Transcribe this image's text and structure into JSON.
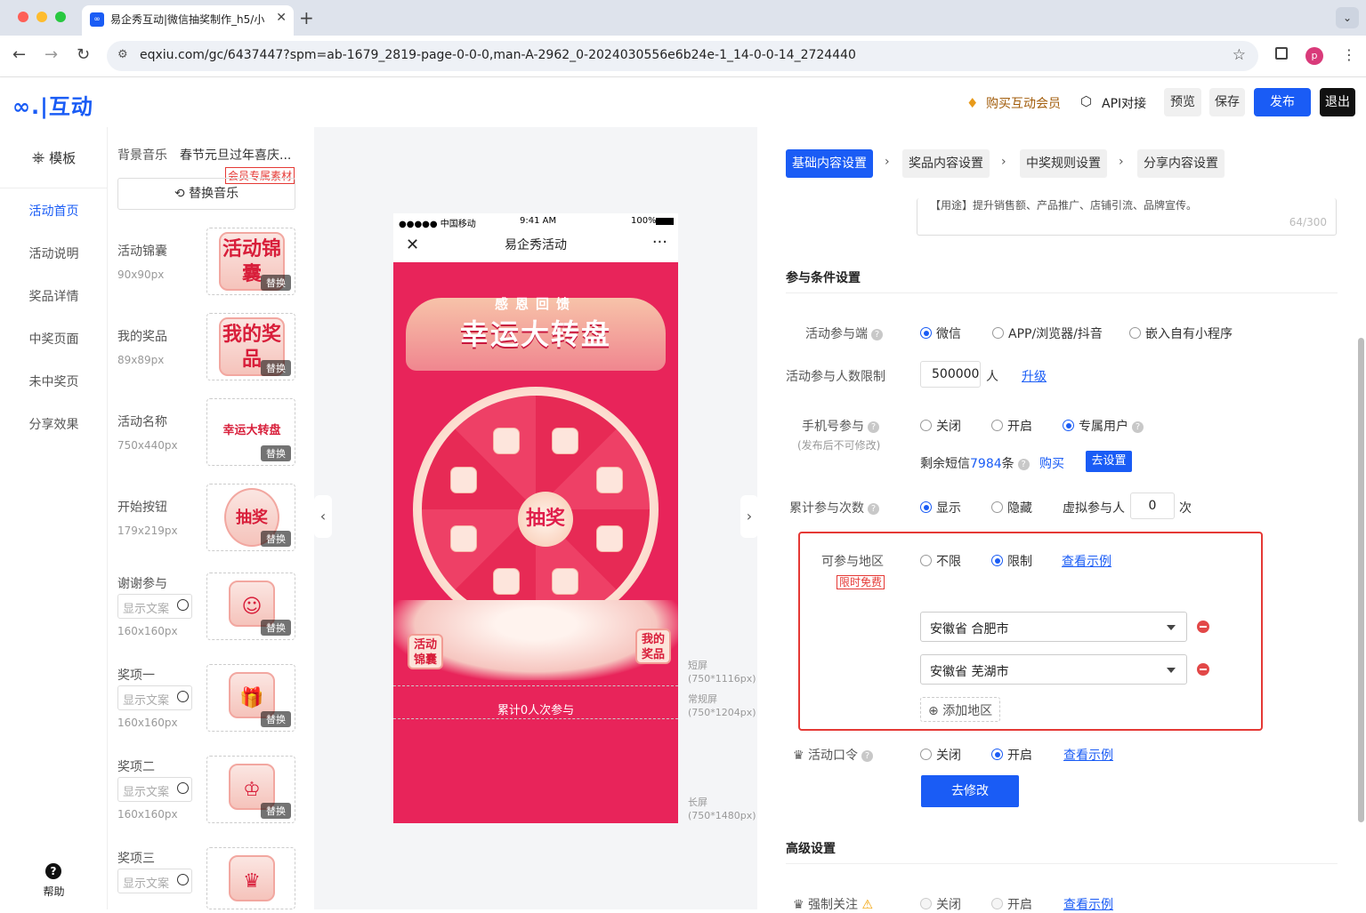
{
  "browser": {
    "tab_title": "易企秀互动|微信抽奖制作_h5/小",
    "url": "eqxiu.com/gc/6437447?spm=ab-1679_2819-page-0-0-0,man-A-2962_0-2024030556e6b24e-1_14-0-0-14_2724440",
    "avatar": "p"
  },
  "header": {
    "logo": "互动",
    "vip": "购买互动会员",
    "api": "API对接",
    "preview": "预览",
    "save": "保存",
    "publish": "发布",
    "exit": "退出"
  },
  "leftnav": {
    "template": "模板",
    "items": [
      "活动首页",
      "活动说明",
      "奖品详情",
      "中奖页面",
      "未中奖页",
      "分享效果"
    ],
    "help": "帮助"
  },
  "assets": {
    "music_label": "背景音乐",
    "music_name": "春节元旦过年喜庆...",
    "vip_tag": "会员专属素材",
    "replace_music": "替换音乐",
    "replace": "替换",
    "text_placeholder": "显示文案",
    "items": [
      {
        "label": "活动锦囊",
        "size": "90x90px",
        "img": "活动锦囊"
      },
      {
        "label": "我的奖品",
        "size": "89x89px",
        "img": "我的奖品"
      },
      {
        "label": "活动名称",
        "size": "750x440px",
        "img": "幸运大转盘"
      },
      {
        "label": "开始按钮",
        "size": "179x219px",
        "img": "抽奖"
      },
      {
        "label": "谢谢参与",
        "size": "160x160px",
        "img": "☺"
      },
      {
        "label": "奖项一",
        "size": "160x160px",
        "img": "🎁"
      },
      {
        "label": "奖项二",
        "size": "160x160px",
        "img": "♔"
      },
      {
        "label": "奖项三",
        "size": "",
        "img": "♛"
      }
    ]
  },
  "phone": {
    "carrier": "●●●●● 中国移动",
    "time": "9:41 AM",
    "battery": "100%",
    "title": "易企秀活动",
    "banner_top": "感恩回馈",
    "banner": "幸运大转盘",
    "start": "抽奖",
    "tip_left": "活动锦囊",
    "tip_right": "我的奖品",
    "count": "累计0人次参与"
  },
  "guides": [
    {
      "name": "短屏",
      "size": "(750*1116px)"
    },
    {
      "name": "常规屏",
      "size": "(750*1204px)"
    },
    {
      "name": "长屏",
      "size": "(750*1480px)"
    }
  ],
  "right": {
    "steps": [
      "基础内容设置",
      "奖品内容设置",
      "中奖规则设置",
      "分享内容设置"
    ],
    "desc_text": "【用途】提升销售额、产品推广、店铺引流、品牌宣传。",
    "desc_count": "64/300",
    "sec_join": "参与条件设置",
    "platform_label": "活动参与端",
    "platform_opts": [
      "微信",
      "APP/浏览器/抖音",
      "嵌入自有小程序"
    ],
    "limit_label": "活动参与人数限制",
    "limit_value": "500000",
    "limit_unit": "人",
    "upgrade": "升级",
    "phone_label": "手机号参与",
    "phone_sub": "(发布后不可修改)",
    "phone_opts": [
      "关闭",
      "开启",
      "专属用户"
    ],
    "sms_prefix": "剩余短信",
    "sms_count": "7984",
    "sms_suffix": "条",
    "buy": "购买",
    "goset": "去设置",
    "cum_label": "累计参与次数",
    "cum_opts": [
      "显示",
      "隐藏"
    ],
    "virtual_label": "虚拟参与人",
    "virtual_value": "0",
    "virtual_unit": "次",
    "region_label": "可参与地区",
    "free_tag": "限时免费",
    "region_opts": [
      "不限",
      "限制"
    ],
    "example": "查看示例",
    "regions": [
      "安徽省 合肥市",
      "安徽省 芜湖市"
    ],
    "add_region": "添加地区",
    "pwd_label": "活动口令",
    "pwd_opts": [
      "关闭",
      "开启"
    ],
    "modify": "去修改",
    "sec_adv": "高级设置",
    "follow_label": "强制关注",
    "follow_opts": [
      "关闭",
      "开启"
    ]
  }
}
